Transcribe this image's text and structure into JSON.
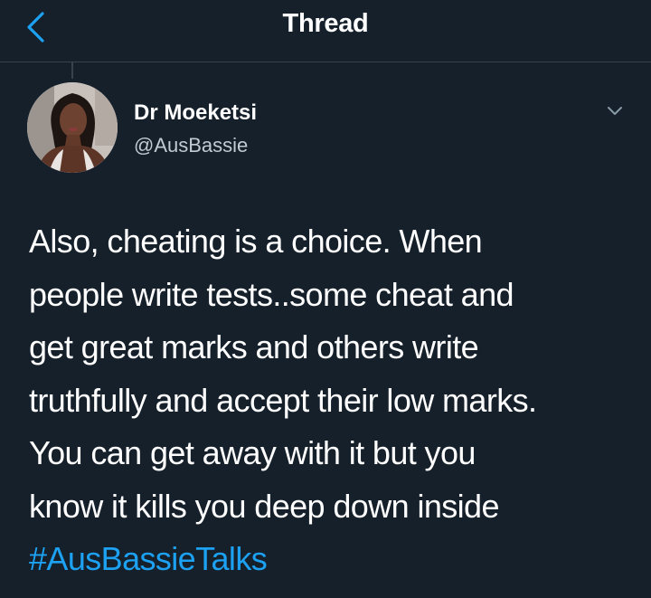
{
  "header": {
    "title": "Thread",
    "back_icon": "chevron-left-icon"
  },
  "colors": {
    "background": "#15202b",
    "accent": "#1da1f2",
    "divider": "#38444d",
    "secondary_text": "#c2cad2"
  },
  "tweet": {
    "author": {
      "name": "Dr Moeketsi",
      "handle": "@AusBassie",
      "avatar_icon": "profile-photo"
    },
    "menu_icon": "chevron-down-icon",
    "lines": [
      "Also, cheating is a choice. When",
      "people write tests..some cheat and",
      "get great marks and others write",
      "truthfully and accept their low marks.",
      "You can get away with it but you",
      "know it kills you deep down inside"
    ],
    "hashtag": "#AusBassieTalks"
  }
}
